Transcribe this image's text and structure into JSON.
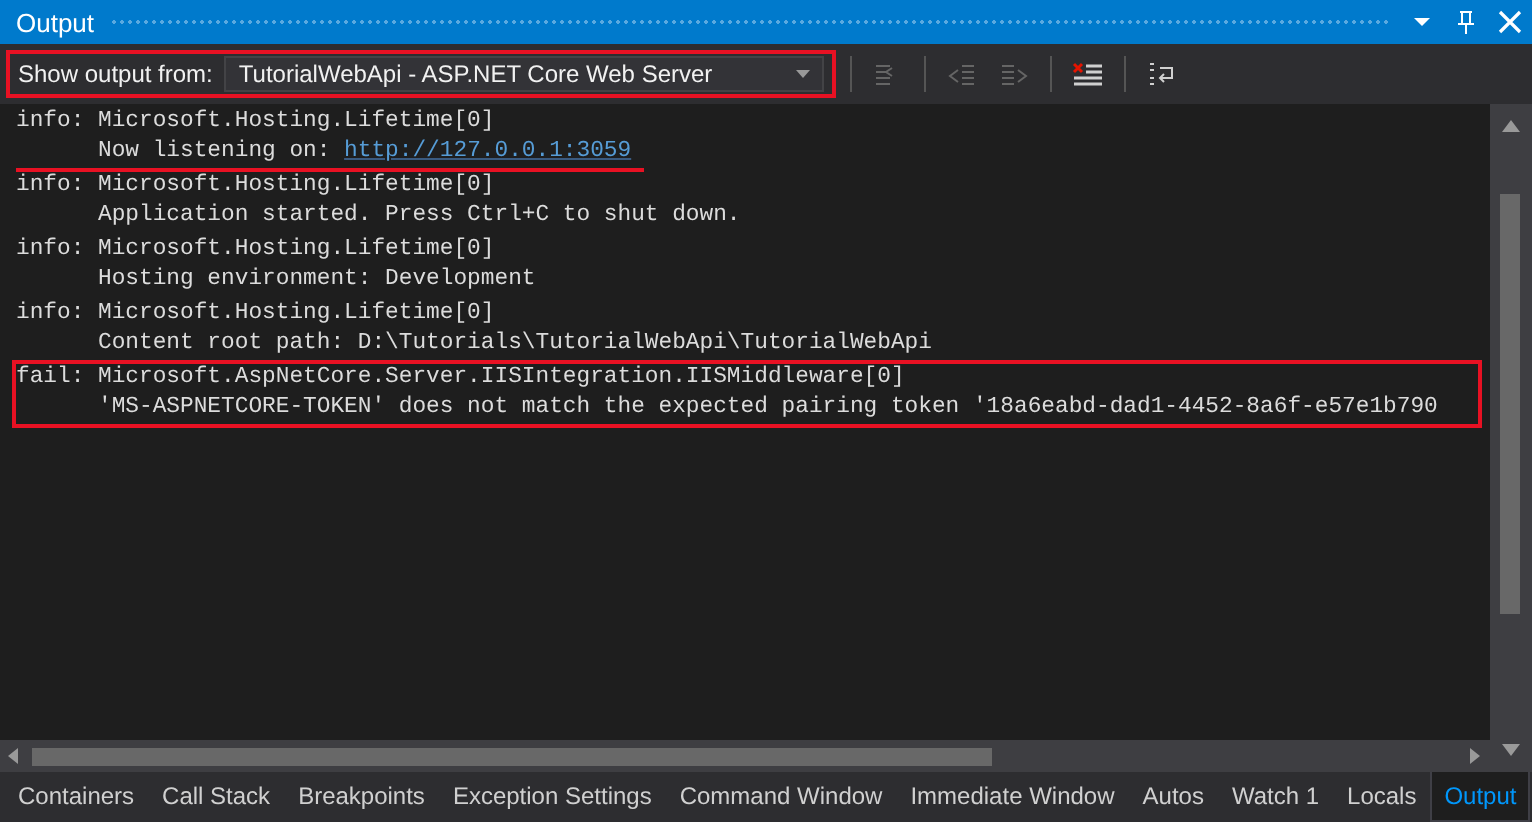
{
  "window": {
    "title": "Output"
  },
  "toolbar": {
    "source_label": "Show output from:",
    "source_value": "TutorialWebApi - ASP.NET Core Web Server",
    "highlighted": true,
    "buttons": [
      {
        "kind": "goto",
        "disabled": true
      },
      {
        "kind": "previous",
        "disabled": true
      },
      {
        "kind": "next",
        "disabled": true
      },
      {
        "kind": "clear",
        "disabled": false
      },
      {
        "kind": "wrap",
        "disabled": false
      }
    ]
  },
  "log": [
    {
      "level": "info:",
      "source": "Microsoft.Hosting.Lifetime[0]",
      "message": "Now listening on: ",
      "link": "http://127.0.0.1:3059",
      "highlighted": false,
      "underlined": true
    },
    {
      "level": "info:",
      "source": "Microsoft.Hosting.Lifetime[0]",
      "message": "Application started. Press Ctrl+C to shut down.",
      "highlighted": false,
      "underlined": false
    },
    {
      "level": "info:",
      "source": "Microsoft.Hosting.Lifetime[0]",
      "message": "Hosting environment: Development",
      "highlighted": false,
      "underlined": false
    },
    {
      "level": "info:",
      "source": "Microsoft.Hosting.Lifetime[0]",
      "message": "Content root path: D:\\Tutorials\\TutorialWebApi\\TutorialWebApi",
      "highlighted": false,
      "underlined": false
    },
    {
      "level": "fail:",
      "source": "Microsoft.AspNetCore.Server.IISIntegration.IISMiddleware[0]",
      "message": "'MS-ASPNETCORE-TOKEN' does not match the expected pairing token '18a6eabd-dad1-4452-8a6f-e57e1b790",
      "highlighted": true,
      "underlined": false
    }
  ],
  "tabs": [
    {
      "label": "Containers",
      "selected": false
    },
    {
      "label": "Call Stack",
      "selected": false
    },
    {
      "label": "Breakpoints",
      "selected": false
    },
    {
      "label": "Exception Settings",
      "selected": false
    },
    {
      "label": "Command Window",
      "selected": false
    },
    {
      "label": "Immediate Window",
      "selected": false
    },
    {
      "label": "Autos",
      "selected": false
    },
    {
      "label": "Watch 1",
      "selected": false
    },
    {
      "label": "Locals",
      "selected": false
    },
    {
      "label": "Output",
      "selected": true
    }
  ]
}
